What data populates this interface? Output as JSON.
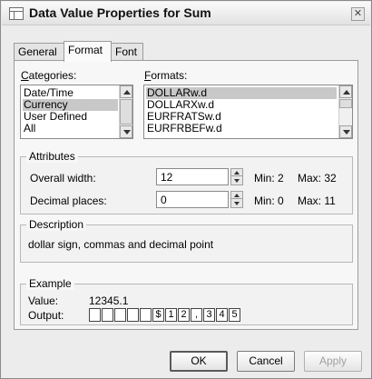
{
  "window": {
    "title": "Data Value Properties for Sum"
  },
  "tabs": [
    {
      "label": "General"
    },
    {
      "label": "Format"
    },
    {
      "label": "Font"
    }
  ],
  "categories": {
    "label": "Categories:",
    "items": [
      "Date/Time",
      "Currency",
      "User Defined",
      "All"
    ],
    "selected": "Currency"
  },
  "formats": {
    "label": "Formats:",
    "items": [
      "DOLLARw.d",
      "DOLLARXw.d",
      "EURFRATSw.d",
      "EURFRBEFw.d"
    ],
    "selected": "DOLLARw.d"
  },
  "attributes": {
    "title": "Attributes",
    "overall_width": {
      "label": "Overall width:",
      "value": "12",
      "min": "Min:  2",
      "max": "Max:  32"
    },
    "decimal_places": {
      "label": "Decimal places:",
      "value": "0",
      "min": "Min:  0",
      "max": "Max:  11"
    }
  },
  "description": {
    "title": "Description",
    "text": "dollar sign, commas and decimal point"
  },
  "example": {
    "title": "Example",
    "value_label": "Value:",
    "value": "12345.1",
    "output_label": "Output:",
    "output_cells": [
      "",
      "",
      "",
      "",
      "",
      "$",
      "1",
      "2",
      ",",
      "3",
      "4",
      "5"
    ]
  },
  "buttons": {
    "ok": "OK",
    "cancel": "Cancel",
    "apply": "Apply"
  },
  "icons": {
    "close": "close-icon",
    "window": "window-icon"
  }
}
